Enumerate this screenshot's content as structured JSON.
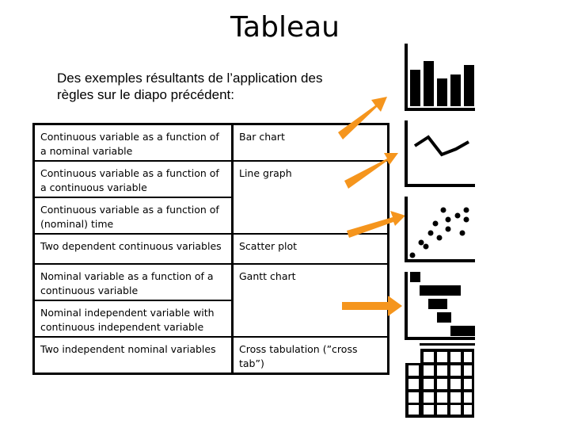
{
  "slide": {
    "title": "Tableau",
    "subtitle_line1": "Des exemples résultants de l’application des",
    "subtitle_line2": "règles sur le diapo précédent:"
  },
  "table": {
    "rows": [
      {
        "condition": "Continuous variable as a function of a nominal variable",
        "chart": "Bar chart"
      },
      {
        "condition": "Continuous variable as a function of a continuous variable",
        "chart": "Line graph"
      },
      {
        "condition": "Continuous variable as a function of (nominal) time",
        "chart": ""
      },
      {
        "condition": "Two dependent continuous variables",
        "chart": "Scatter plot"
      },
      {
        "condition": "Nominal variable as a function of a continuous variable",
        "chart": "Gantt chart"
      },
      {
        "condition": "Nominal independent variable with continuous independent variable",
        "chart": ""
      },
      {
        "condition": "Two independent nominal variables",
        "chart": "Cross tabulation (”cross tab”)"
      }
    ]
  },
  "icons": [
    "bar-chart-icon",
    "line-graph-icon",
    "scatter-plot-icon",
    "gantt-chart-icon",
    "cross-tab-grid-icon"
  ],
  "colors": {
    "arrow": "#f5951d",
    "ink": "#000000"
  }
}
